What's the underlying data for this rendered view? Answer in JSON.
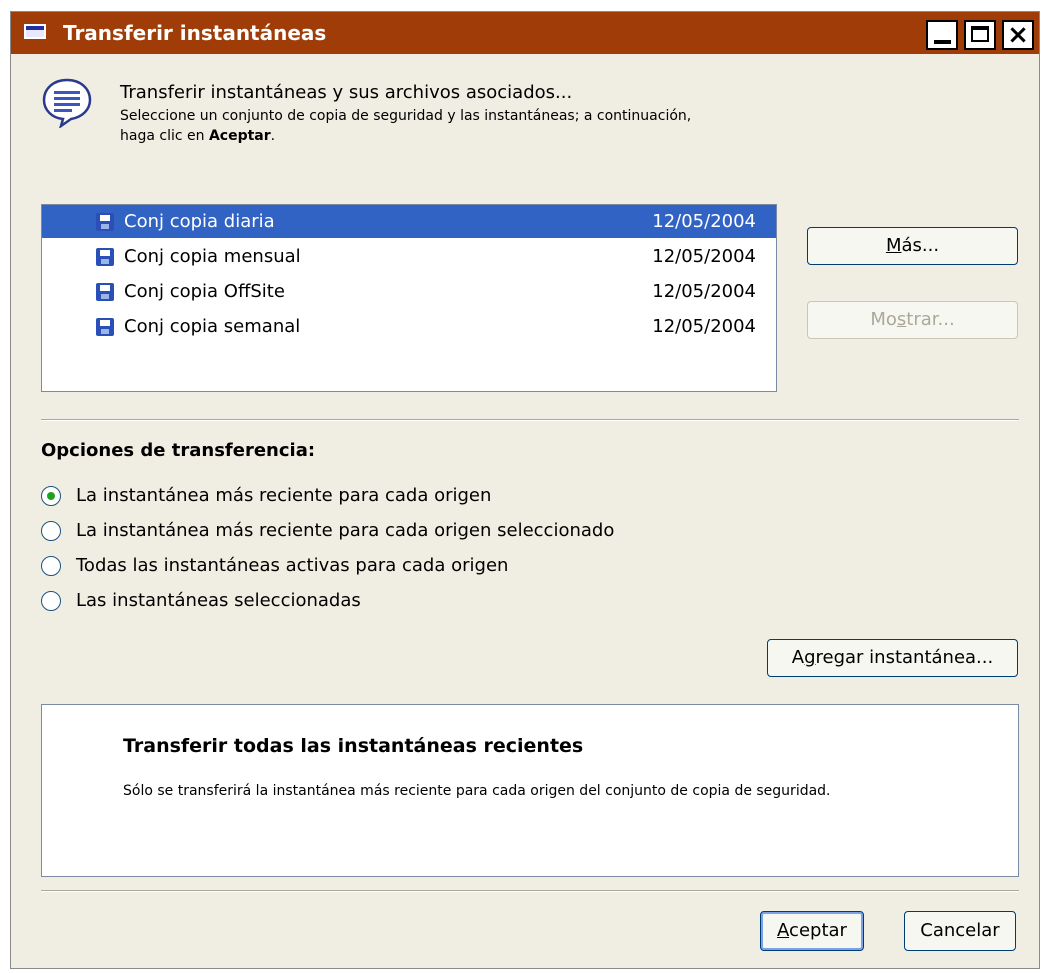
{
  "window": {
    "title": "Transferir instantáneas"
  },
  "title_buttons": {
    "minimize": "minimize-icon",
    "maximize": "maximize-icon",
    "close": "×"
  },
  "intro": {
    "main": "Transferir instantáneas y sus archivos asociados...",
    "sub_line1": "Seleccione un conjunto de copia de seguridad y las instantáneas; a continuación,",
    "sub_line2_prefix": "haga clic en ",
    "sub_line2_bold": "Aceptar",
    "sub_line2_suffix": "."
  },
  "backup_sets": [
    {
      "name": "Conj copia diaria",
      "date": "12/05/2004",
      "selected": true
    },
    {
      "name": "Conj copia mensual",
      "date": "12/05/2004",
      "selected": false
    },
    {
      "name": "Conj copia OffSite",
      "date": "12/05/2004",
      "selected": false
    },
    {
      "name": "Conj copia semanal",
      "date": "12/05/2004",
      "selected": false
    }
  ],
  "buttons": {
    "mas_prefix": "",
    "mas_underline": "M",
    "mas_suffix": "ás...",
    "mostrar_prefix": "Mo",
    "mostrar_underline": "s",
    "mostrar_suffix": "trar...",
    "agregar_prefix": "A",
    "agregar_underline": "g",
    "agregar_suffix": "regar instantánea...",
    "aceptar_prefix": "",
    "aceptar_underline": "A",
    "aceptar_suffix": "ceptar",
    "cancelar": "Cancelar"
  },
  "transfer_options": {
    "label": "Opciones de transferencia:",
    "options": [
      {
        "label": "La instantánea más reciente para cada origen",
        "checked": true
      },
      {
        "label": "La instantánea más reciente para cada origen seleccionado",
        "checked": false
      },
      {
        "label": "Todas las instantáneas activas para cada origen",
        "checked": false
      },
      {
        "label": "Las instantáneas seleccionadas",
        "checked": false
      }
    ]
  },
  "description": {
    "title": "Transferir todas las instantáneas recientes",
    "text": "Sólo se transferirá la instantánea más reciente para cada origen del conjunto de copia de seguridad."
  },
  "colors": {
    "titlebar": "#a03c07",
    "selection": "#3163c5",
    "dialog_bg": "#f0eee2"
  }
}
